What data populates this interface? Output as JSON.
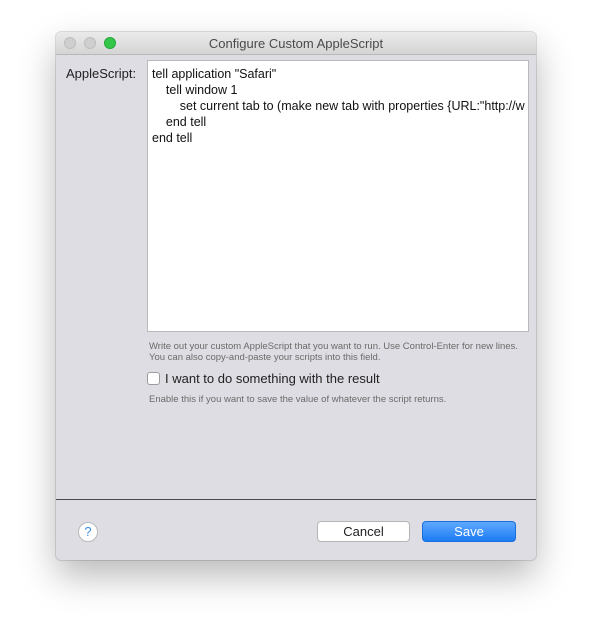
{
  "window": {
    "title": "Configure Custom AppleScript"
  },
  "form": {
    "applescript_label": "AppleScript:",
    "script_lines": [
      "tell application \"Safari\"",
      "    tell window 1",
      "        set current tab to (make new tab with properties {URL:\"http://w",
      "    end tell",
      "end tell"
    ],
    "script_help": "Write out your custom AppleScript that you want to run.  Use Control-Enter for new lines.  You can also copy-and-paste your scripts into this field.",
    "checkbox_label": "I want to do something with the result",
    "checkbox_checked": false,
    "checkbox_help": "Enable this if you want to save the value of whatever the script returns."
  },
  "footer": {
    "help_glyph": "?",
    "cancel_label": "Cancel",
    "save_label": "Save"
  },
  "icons": {
    "help": "question-mark-icon"
  },
  "colors": {
    "accent": "#1c7cf4",
    "window_bg": "#dddde3",
    "zoom_button": "#35c649"
  }
}
